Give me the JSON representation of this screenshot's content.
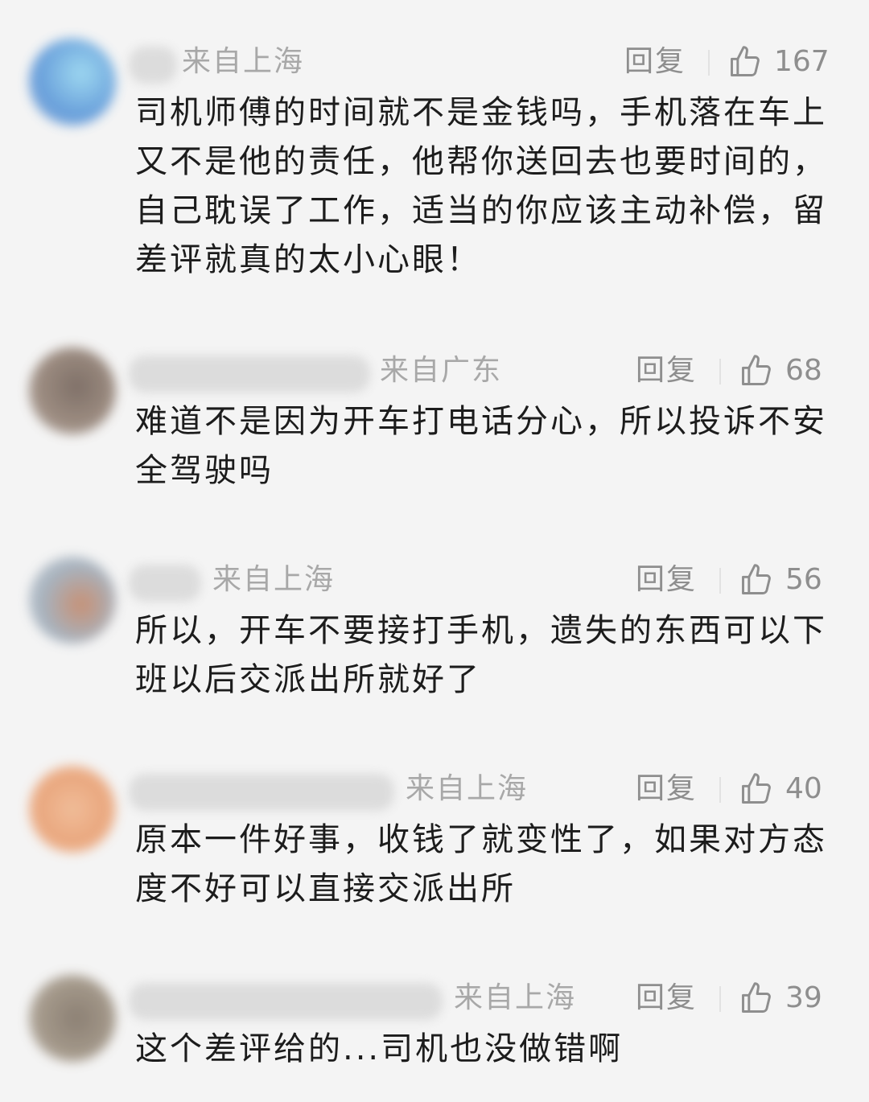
{
  "comments": [
    {
      "location": "来自上海",
      "reply": "回复",
      "likes": "167",
      "text": "司机师傅的时间就不是金钱吗，手机落在车上又不是他的责任，他帮你送回去也要时间的，自己耽误了工作，适当的你应该主动补偿，留差评就真的太小心眼！"
    },
    {
      "location": "来自广东",
      "reply": "回复",
      "likes": "68",
      "text": "难道不是因为开车打电话分心，所以投诉不安全驾驶吗"
    },
    {
      "location": "来自上海",
      "reply": "回复",
      "likes": "56",
      "text": "所以，开车不要接打手机，遗失的东西可以下班以后交派出所就好了"
    },
    {
      "location": "来自上海",
      "reply": "回复",
      "likes": "40",
      "text": "原本一件好事，收钱了就变性了，如果对方态度不好可以直接交派出所"
    },
    {
      "location": "来自上海",
      "reply": "回复",
      "likes": "39",
      "text": "这个差评给的...司机也没做错啊"
    }
  ]
}
